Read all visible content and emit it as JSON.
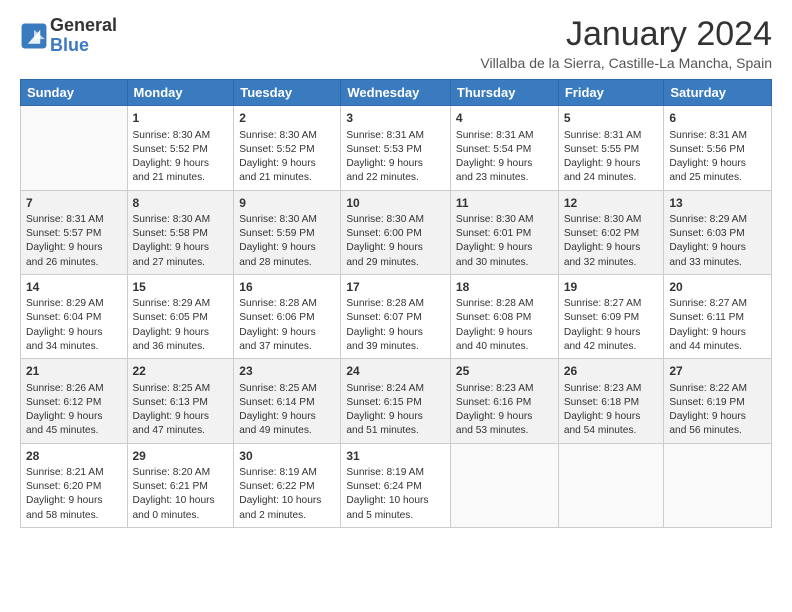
{
  "logo": {
    "text_general": "General",
    "text_blue": "Blue"
  },
  "header": {
    "month": "January 2024",
    "location": "Villalba de la Sierra, Castille-La Mancha, Spain"
  },
  "weekdays": [
    "Sunday",
    "Monday",
    "Tuesday",
    "Wednesday",
    "Thursday",
    "Friday",
    "Saturday"
  ],
  "weeks": [
    [
      {
        "day": "",
        "info": ""
      },
      {
        "day": "1",
        "info": "Sunrise: 8:30 AM\nSunset: 5:52 PM\nDaylight: 9 hours\nand 21 minutes."
      },
      {
        "day": "2",
        "info": "Sunrise: 8:30 AM\nSunset: 5:52 PM\nDaylight: 9 hours\nand 21 minutes."
      },
      {
        "day": "3",
        "info": "Sunrise: 8:31 AM\nSunset: 5:53 PM\nDaylight: 9 hours\nand 22 minutes."
      },
      {
        "day": "4",
        "info": "Sunrise: 8:31 AM\nSunset: 5:54 PM\nDaylight: 9 hours\nand 23 minutes."
      },
      {
        "day": "5",
        "info": "Sunrise: 8:31 AM\nSunset: 5:55 PM\nDaylight: 9 hours\nand 24 minutes."
      },
      {
        "day": "6",
        "info": "Sunrise: 8:31 AM\nSunset: 5:56 PM\nDaylight: 9 hours\nand 25 minutes."
      }
    ],
    [
      {
        "day": "7",
        "info": "Sunrise: 8:31 AM\nSunset: 5:57 PM\nDaylight: 9 hours\nand 26 minutes."
      },
      {
        "day": "8",
        "info": "Sunrise: 8:30 AM\nSunset: 5:58 PM\nDaylight: 9 hours\nand 27 minutes."
      },
      {
        "day": "9",
        "info": "Sunrise: 8:30 AM\nSunset: 5:59 PM\nDaylight: 9 hours\nand 28 minutes."
      },
      {
        "day": "10",
        "info": "Sunrise: 8:30 AM\nSunset: 6:00 PM\nDaylight: 9 hours\nand 29 minutes."
      },
      {
        "day": "11",
        "info": "Sunrise: 8:30 AM\nSunset: 6:01 PM\nDaylight: 9 hours\nand 30 minutes."
      },
      {
        "day": "12",
        "info": "Sunrise: 8:30 AM\nSunset: 6:02 PM\nDaylight: 9 hours\nand 32 minutes."
      },
      {
        "day": "13",
        "info": "Sunrise: 8:29 AM\nSunset: 6:03 PM\nDaylight: 9 hours\nand 33 minutes."
      }
    ],
    [
      {
        "day": "14",
        "info": "Sunrise: 8:29 AM\nSunset: 6:04 PM\nDaylight: 9 hours\nand 34 minutes."
      },
      {
        "day": "15",
        "info": "Sunrise: 8:29 AM\nSunset: 6:05 PM\nDaylight: 9 hours\nand 36 minutes."
      },
      {
        "day": "16",
        "info": "Sunrise: 8:28 AM\nSunset: 6:06 PM\nDaylight: 9 hours\nand 37 minutes."
      },
      {
        "day": "17",
        "info": "Sunrise: 8:28 AM\nSunset: 6:07 PM\nDaylight: 9 hours\nand 39 minutes."
      },
      {
        "day": "18",
        "info": "Sunrise: 8:28 AM\nSunset: 6:08 PM\nDaylight: 9 hours\nand 40 minutes."
      },
      {
        "day": "19",
        "info": "Sunrise: 8:27 AM\nSunset: 6:09 PM\nDaylight: 9 hours\nand 42 minutes."
      },
      {
        "day": "20",
        "info": "Sunrise: 8:27 AM\nSunset: 6:11 PM\nDaylight: 9 hours\nand 44 minutes."
      }
    ],
    [
      {
        "day": "21",
        "info": "Sunrise: 8:26 AM\nSunset: 6:12 PM\nDaylight: 9 hours\nand 45 minutes."
      },
      {
        "day": "22",
        "info": "Sunrise: 8:25 AM\nSunset: 6:13 PM\nDaylight: 9 hours\nand 47 minutes."
      },
      {
        "day": "23",
        "info": "Sunrise: 8:25 AM\nSunset: 6:14 PM\nDaylight: 9 hours\nand 49 minutes."
      },
      {
        "day": "24",
        "info": "Sunrise: 8:24 AM\nSunset: 6:15 PM\nDaylight: 9 hours\nand 51 minutes."
      },
      {
        "day": "25",
        "info": "Sunrise: 8:23 AM\nSunset: 6:16 PM\nDaylight: 9 hours\nand 53 minutes."
      },
      {
        "day": "26",
        "info": "Sunrise: 8:23 AM\nSunset: 6:18 PM\nDaylight: 9 hours\nand 54 minutes."
      },
      {
        "day": "27",
        "info": "Sunrise: 8:22 AM\nSunset: 6:19 PM\nDaylight: 9 hours\nand 56 minutes."
      }
    ],
    [
      {
        "day": "28",
        "info": "Sunrise: 8:21 AM\nSunset: 6:20 PM\nDaylight: 9 hours\nand 58 minutes."
      },
      {
        "day": "29",
        "info": "Sunrise: 8:20 AM\nSunset: 6:21 PM\nDaylight: 10 hours\nand 0 minutes."
      },
      {
        "day": "30",
        "info": "Sunrise: 8:19 AM\nSunset: 6:22 PM\nDaylight: 10 hours\nand 2 minutes."
      },
      {
        "day": "31",
        "info": "Sunrise: 8:19 AM\nSunset: 6:24 PM\nDaylight: 10 hours\nand 5 minutes."
      },
      {
        "day": "",
        "info": ""
      },
      {
        "day": "",
        "info": ""
      },
      {
        "day": "",
        "info": ""
      }
    ]
  ]
}
